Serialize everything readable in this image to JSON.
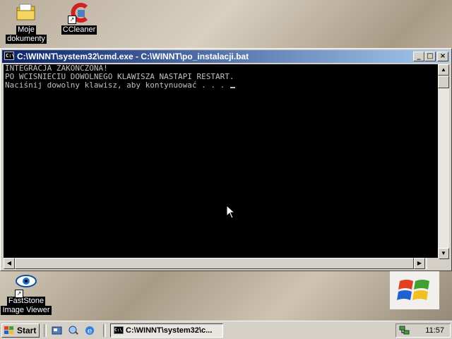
{
  "desktop": {
    "icons": [
      {
        "label_line1": "Moje",
        "label_line2": "dokumenty"
      },
      {
        "label_line1": "CCleaner"
      },
      {
        "label_line1": "FastStone",
        "label_line2": "Image Viewer"
      }
    ]
  },
  "window": {
    "title": "C:\\WINNT\\system32\\cmd.exe - C:\\WINNT\\po_instalacji.bat",
    "icon_text": "C:\\",
    "buttons": {
      "minimize": "_",
      "maximize": "□",
      "close": "×"
    },
    "console_lines": [
      "INTEGRACJA ZAKONCZONA!",
      "PO WCISNIECIU DOWOLNEGO KLAWISZA NASTAPI RESTART.",
      "Naciśnij dowolny klawisz, aby kontynuować . . . "
    ]
  },
  "taskbar": {
    "start_label": "Start",
    "task_label": "C:\\WINNT\\system32\\c...",
    "clock": "11:57"
  },
  "colors": {
    "titlebar_start": "#0a246a",
    "titlebar_end": "#a6caf0",
    "console_bg": "#000000",
    "console_fg": "#c0c0c0"
  }
}
